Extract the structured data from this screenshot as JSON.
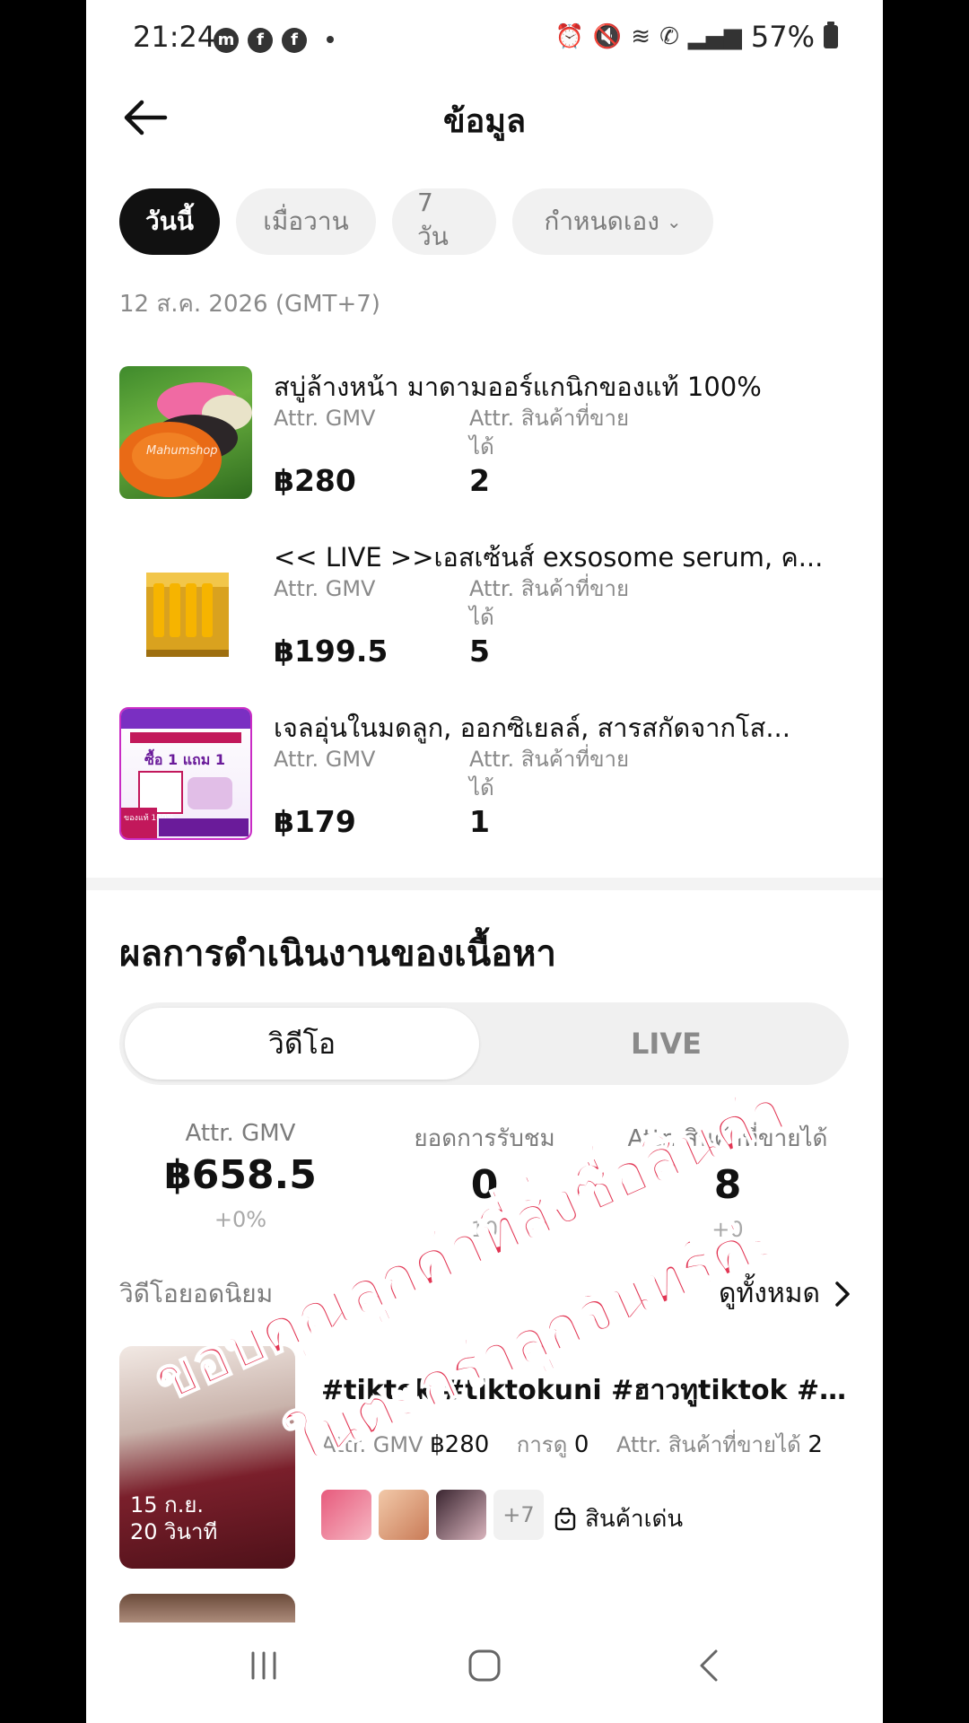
{
  "status_bar": {
    "time": "21:24",
    "battery": "57%",
    "apps": [
      "messenger-icon",
      "facebook-icon",
      "facebook-icon"
    ]
  },
  "header": {
    "title": "ข้อมูล"
  },
  "filters": {
    "chips": [
      "วันนี้",
      "เมื่อวาน",
      "7 วัน",
      "กำหนดเอง"
    ],
    "active": "วันนี้"
  },
  "date_label": "12 ส.ค. 2026 (GMT+7)",
  "products": [
    {
      "name": "สบู่ล้างหน้า มาดามออร์แกนิกของแท้ 100%",
      "gmv_label": "Attr. GMV",
      "sold_label": "Attr. สินค้าที่ขายได้",
      "gmv": "฿280",
      "sold": "2",
      "thumb_text": "Mahumshop"
    },
    {
      "name": "<< LIVE >>เอสเซ้นส์ exsosome serum, ค...",
      "gmv_label": "Attr. GMV",
      "sold_label": "Attr. สินค้าที่ขายได้",
      "gmv": "฿199.5",
      "sold": "5"
    },
    {
      "name": "เจลอุ่นในมดลูก, ออกซิเยลล์, สารสกัดจากโส...",
      "gmv_label": "Attr. GMV",
      "sold_label": "Attr. สินค้าที่ขายได้",
      "gmv": "฿179",
      "sold": "1",
      "thumb_text": "ซื้อ 1 แถม 1",
      "thumb_badge": "ของแท้ 100%"
    }
  ],
  "content_section": {
    "title": "ผลการดำเนินงานของเนื้อหา",
    "tabs": [
      "วิดีโอ",
      "LIVE"
    ],
    "active_tab": "วิดีโอ",
    "stats": [
      {
        "label": "Attr. GMV",
        "value": "฿658.5",
        "change": "+0%"
      },
      {
        "label": "ยอดการรับชม",
        "value": "0",
        "change": "10"
      },
      {
        "label": "Attr. สินค้าที่ขายได้",
        "value": "8",
        "change": "+0"
      }
    ],
    "videos_heading": "วิดีโอยอดนิยม",
    "see_all": "ดูทั้งหมด"
  },
  "top_video": {
    "title": "#tiktok #tiktokuni #ฮาวทูtiktok #tikt...",
    "gmv_label": "Attr. GMV",
    "gmv": "฿280",
    "views_label": "การดู",
    "views": "0",
    "sold_label": "Attr. สินค้าที่ขายได้",
    "sold": "2",
    "date": "15 ก.ย.",
    "duration": "20 วินาที",
    "more_products": "+7",
    "featured_label": "สินค้าเด่น"
  },
  "overlay_text": {
    "line1": "ขอบคุณลูกค้าที่สั่งซื้อสินค้า",
    "line2": "ในตะกร้าลูกจันทร์ค่ะ"
  }
}
